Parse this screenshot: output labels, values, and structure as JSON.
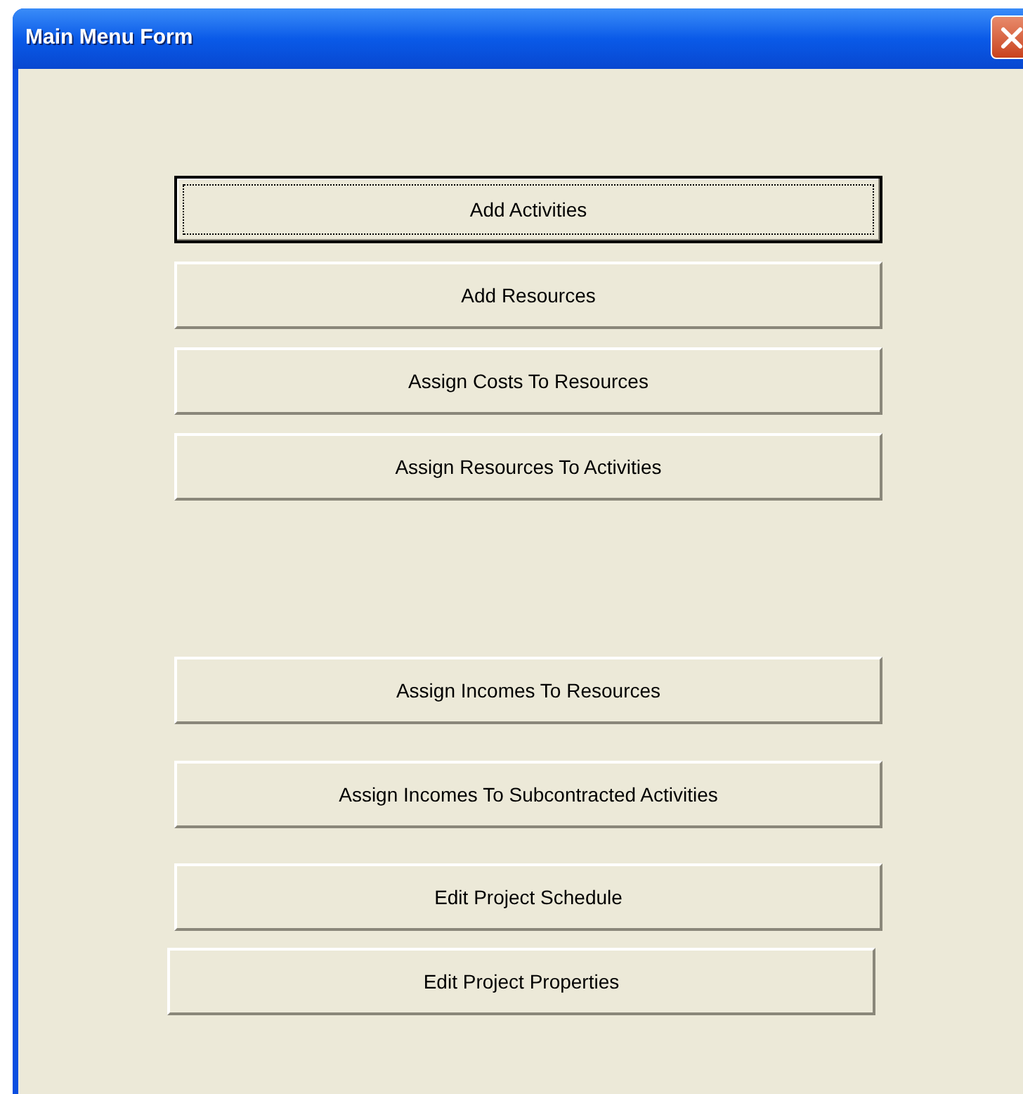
{
  "window": {
    "title": "Main Menu Form"
  },
  "buttons": [
    {
      "label": "Add Activities",
      "focused": true
    },
    {
      "label": "Add Resources",
      "focused": false
    },
    {
      "label": "Assign Costs To Resources",
      "focused": false
    },
    {
      "label": "Assign Resources To Activities",
      "focused": false
    },
    {
      "label": "Assign Incomes To Resources",
      "focused": false
    },
    {
      "label": "Assign Incomes To Subcontracted Activities",
      "focused": false
    },
    {
      "label": "Edit Project Schedule",
      "focused": false
    },
    {
      "label": "Edit Project Properties",
      "focused": false
    }
  ]
}
